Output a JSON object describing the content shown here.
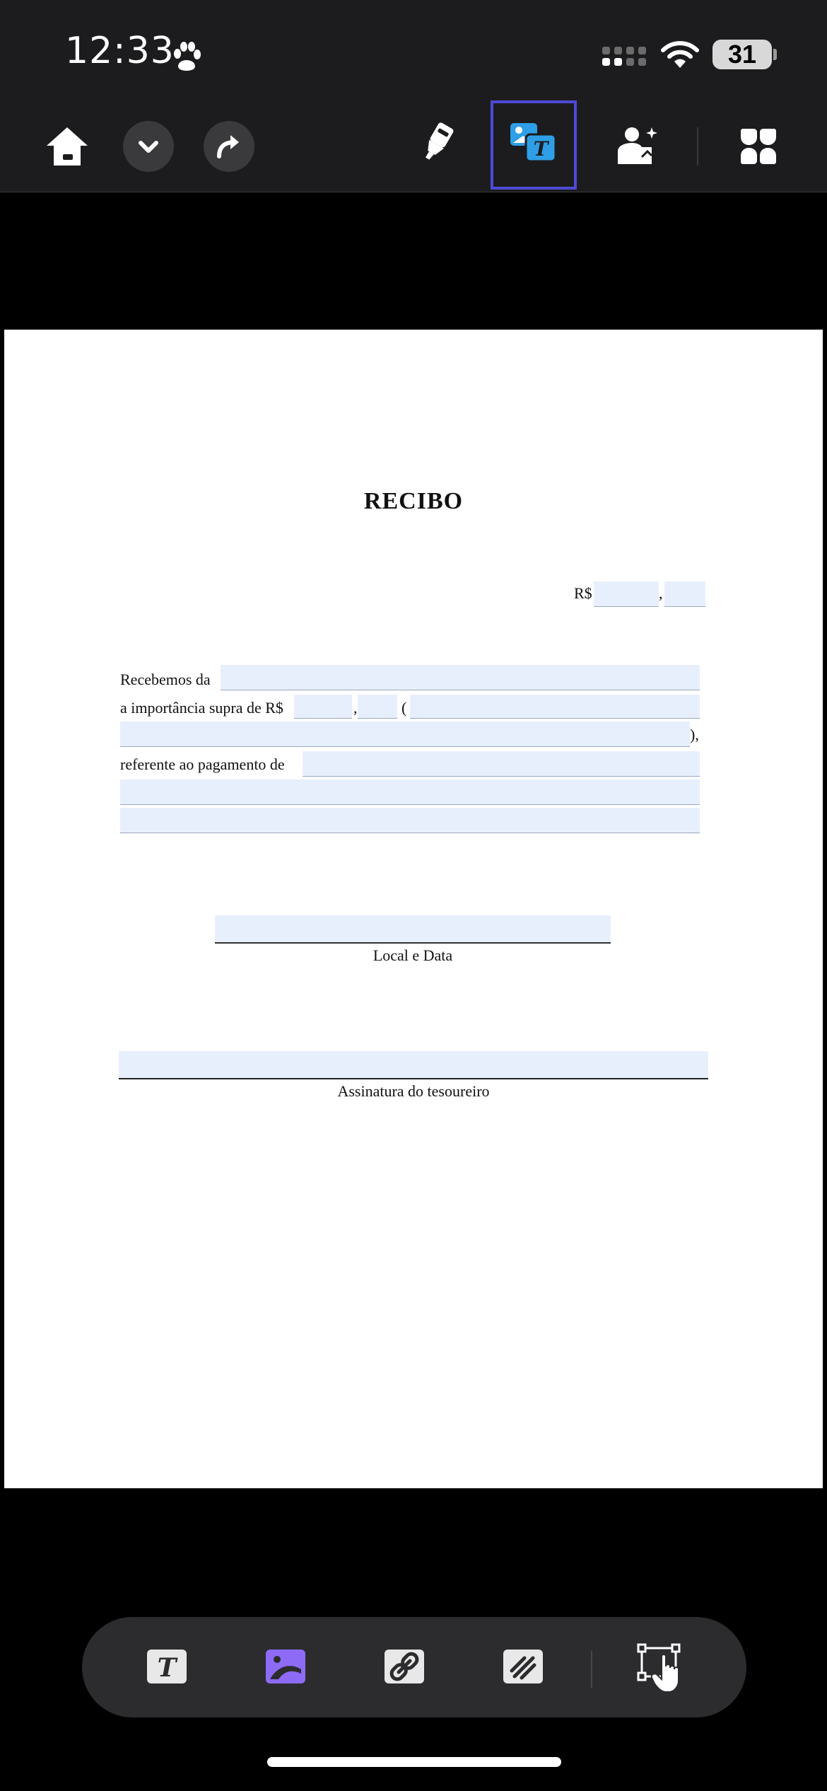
{
  "status_bar": {
    "time": "12:33",
    "battery": "31"
  },
  "toolbar": {
    "home": "home-icon",
    "dropdown": "chevron-down-icon",
    "share": "share-arrow-icon",
    "highlighter": "highlighter-icon",
    "edit_text_image": "edit-text-image-icon",
    "add_image": "add-image-icon",
    "more": "more-grid-icon",
    "accent_color": "#4e4ad6"
  },
  "document": {
    "title": "RECIBO",
    "currency_symbol": "R$",
    "comma": ",",
    "received_from_label": "Recebemos da",
    "amount_label": "a importância supra de R$",
    "open_paren": "(",
    "close_paren": "),",
    "reference_label": "referente ao pagamento de",
    "place_date_label": "Local e Data",
    "signature_label": "Assinatura do tesoureiro",
    "field_color": "#e8effc"
  },
  "bottom_toolbar": {
    "text": "text-tool-icon",
    "image": "image-tool-icon",
    "link": "link-tool-icon",
    "crop": "crop-tool-icon",
    "select": "select-tool-icon",
    "image_active_color": "#8d6bf7"
  }
}
